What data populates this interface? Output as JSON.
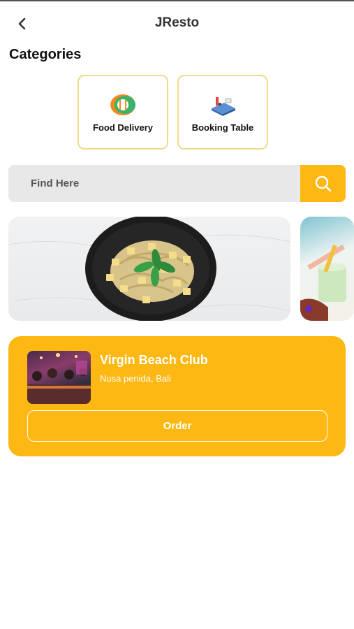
{
  "header": {
    "title": "JResto",
    "back_icon": "chevron-left-icon"
  },
  "categories": {
    "title": "Categories",
    "items": [
      {
        "label": "Food Delivery",
        "icon": "food-delivery-icon"
      },
      {
        "label": "Booking Table",
        "icon": "booking-table-icon"
      }
    ]
  },
  "search": {
    "placeholder": "Find Here",
    "value": "",
    "icon": "search-icon"
  },
  "banners": [
    {
      "image": "pasta-with-tofu-and-basil"
    },
    {
      "image": "cocktail-drinks"
    }
  ],
  "restaurant": {
    "name": "Virgin Beach Club",
    "location": "Nusa penida, Bali",
    "order_label": "Order"
  },
  "colors": {
    "accent": "#fdb813",
    "search_bg": "#e8e8e8",
    "card_border": "#f2d98a"
  }
}
